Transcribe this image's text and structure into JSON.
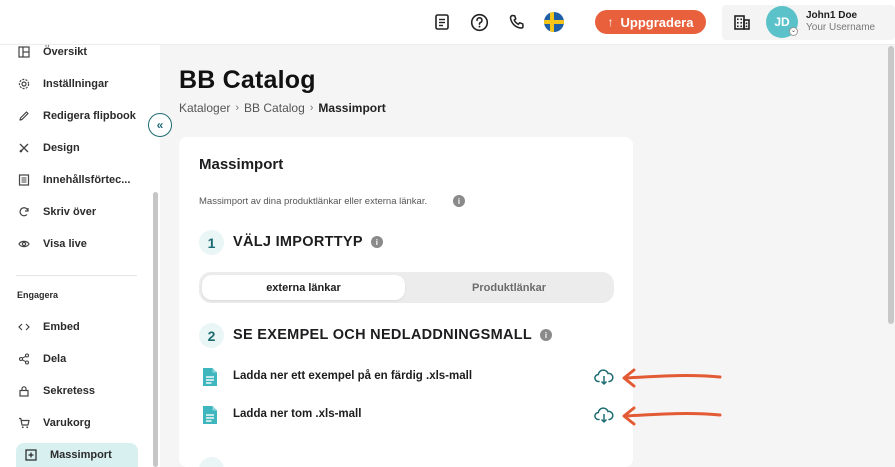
{
  "header": {
    "upgrade_label": "Uppgradera",
    "user": {
      "initials": "JD",
      "name": "John1 Doe",
      "subtitle": "Your Username"
    },
    "icons": [
      "document-icon",
      "help-icon",
      "phone-icon",
      "sweden-flag-icon",
      "building-icon"
    ]
  },
  "sidebar": {
    "items_top": [
      {
        "label": "Översikt",
        "icon": "overview-icon"
      },
      {
        "label": "Inställningar",
        "icon": "gear-icon"
      },
      {
        "label": "Redigera flipbook",
        "icon": "pencil-icon"
      },
      {
        "label": "Design",
        "icon": "design-icon"
      },
      {
        "label": "Innehållsförtec...",
        "icon": "toc-icon"
      },
      {
        "label": "Skriv över",
        "icon": "refresh-icon"
      },
      {
        "label": "Visa live",
        "icon": "eye-icon"
      }
    ],
    "section_label": "Engagera",
    "items_engage": [
      {
        "label": "Embed",
        "icon": "code-icon"
      },
      {
        "label": "Dela",
        "icon": "share-icon"
      },
      {
        "label": "Sekretess",
        "icon": "lock-icon"
      },
      {
        "label": "Varukorg",
        "icon": "cart-icon"
      },
      {
        "label": "Massimport",
        "icon": "import-icon",
        "active": true
      }
    ]
  },
  "page": {
    "title": "BB Catalog",
    "breadcrumb": [
      "Kataloger",
      "BB Catalog",
      "Massimport"
    ]
  },
  "card": {
    "title": "Massimport",
    "description": "Massimport av dina produktlänkar eller externa länkar.",
    "step1": {
      "number": "1",
      "title": "VÄLJ IMPORTTYP"
    },
    "import_types": {
      "selected": "externa länkar",
      "other": "Produktlänkar"
    },
    "step2": {
      "number": "2",
      "title": "SE EXEMPEL OCH NEDLADDNINGSMALL"
    },
    "downloads": [
      {
        "label": "Ladda ner ett exempel på en färdig .xls-mall"
      },
      {
        "label": "Ladda ner tom .xls-mall"
      }
    ]
  },
  "colors": {
    "accent_orange": "#e8613c",
    "teal": "#1c6c72",
    "teal_light": "#5bc2c9",
    "doc_icon": "#3fb5bd",
    "active_nav_bg": "#d9f0f1"
  }
}
